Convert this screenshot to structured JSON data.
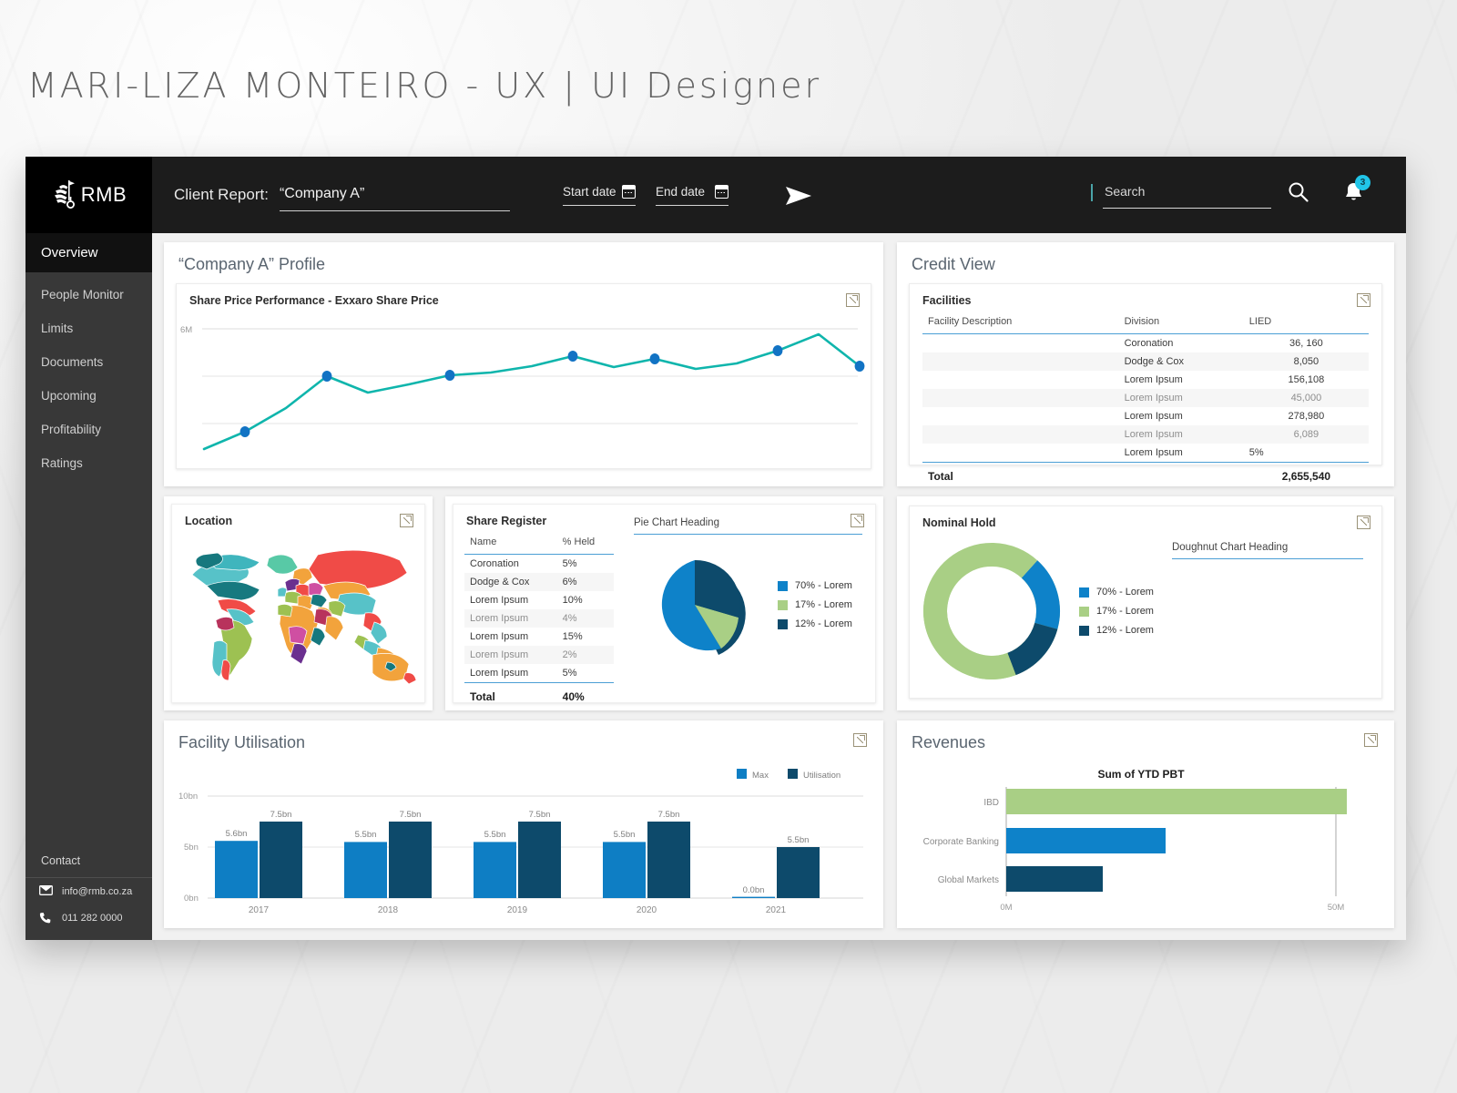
{
  "portfolio_title": "MARI-LIZA MONTEIRO - UX | UI Designer",
  "topbar": {
    "brand": "RMB",
    "client_report_label": "Client Report:",
    "company_value": "“Company A”",
    "start_date_label": "Start date",
    "end_date_label": "End date",
    "send_icon": "send-icon",
    "search_placeholder": "Search",
    "search_value": "",
    "notification_count": "3"
  },
  "sidebar": {
    "items": [
      {
        "label": "Overview",
        "active": true
      },
      {
        "label": "People Monitor",
        "active": false
      },
      {
        "label": "Limits",
        "active": false
      },
      {
        "label": "Documents",
        "active": false
      },
      {
        "label": "Upcoming",
        "active": false
      },
      {
        "label": "Profitability",
        "active": false
      },
      {
        "label": "Ratings",
        "active": false
      }
    ],
    "contact_title": "Contact",
    "email": "info@rmb.co.za",
    "phone": "011 282 0000"
  },
  "profile": {
    "title": "“Company A” Profile",
    "share_price_title": "Share Price Performance - Exxaro Share Price"
  },
  "credit_view": {
    "title": "Credit View"
  },
  "facilities": {
    "heading": "Facilities",
    "columns": [
      "Facility Description",
      "Division",
      "LIED"
    ],
    "rows": [
      {
        "desc": "",
        "division": "Coronation",
        "lied": "36, 160",
        "muted": false
      },
      {
        "desc": "",
        "division": "Dodge & Cox",
        "lied": "8,050",
        "muted": false
      },
      {
        "desc": "",
        "division": "Lorem Ipsum",
        "lied": "156,108",
        "muted": false
      },
      {
        "desc": "",
        "division": "Lorem Ipsum",
        "lied": "45,000",
        "muted": true
      },
      {
        "desc": "",
        "division": "Lorem Ipsum",
        "lied": "278,980",
        "muted": false
      },
      {
        "desc": "",
        "division": "Lorem Ipsum",
        "lied": "6,089",
        "muted": true
      },
      {
        "desc": "",
        "division": "Lorem Ipsum",
        "lied": "5%",
        "muted": false
      }
    ],
    "total_label": "Total",
    "total_value": "2,655,540"
  },
  "location": {
    "heading": "Location"
  },
  "share_register": {
    "heading": "Share Register",
    "columns": [
      "Name",
      "% Held"
    ],
    "rows": [
      {
        "name": "Coronation",
        "held": "5%",
        "muted": false
      },
      {
        "name": "Dodge & Cox",
        "held": "6%",
        "muted": false
      },
      {
        "name": "Lorem Ipsum",
        "held": "10%",
        "muted": false
      },
      {
        "name": "Lorem Ipsum",
        "held": "4%",
        "muted": true
      },
      {
        "name": "Lorem Ipsum",
        "held": "15%",
        "muted": false
      },
      {
        "name": "Lorem Ipsum",
        "held": "2%",
        "muted": true
      },
      {
        "name": "Lorem Ipsum",
        "held": "5%",
        "muted": false
      }
    ],
    "total_label": "Total",
    "total_value": "40%"
  },
  "nominal_hold": {
    "heading": "Nominal Hold",
    "doughnut_heading": "Doughnut Chart Heading"
  },
  "facility_utilisation": {
    "title": "Facility Utilisation"
  },
  "revenues": {
    "title": "Revenues"
  },
  "colors": {
    "blue": "#0e7ec4",
    "navy": "#0d4a6b",
    "green": "#a9cf85",
    "teal_line": "#0fb5ac",
    "dot_blue": "#1273c4",
    "accent_rule": "#4b9fd5",
    "badge": "#21c5e8",
    "sidebar": "#383838",
    "topbar": "#1c1c1c"
  },
  "chart_data": [
    {
      "id": "share-price-performance",
      "type": "line",
      "title": "Share Price Performance - Exxaro Share Price",
      "xlabel": "",
      "ylabel": "",
      "ylim": [
        0,
        6
      ],
      "yticks": [
        6
      ],
      "ytick_labels": [
        "6M"
      ],
      "grid": true,
      "legend": "none",
      "x": [
        0,
        1,
        2,
        3,
        4,
        5,
        6,
        7,
        8,
        9,
        10,
        11,
        12,
        13,
        14,
        15,
        16
      ],
      "values": [
        1.05,
        1.75,
        2.85,
        3.85,
        3.25,
        3.55,
        3.95,
        4.05,
        4.35,
        4.75,
        4.35,
        4.65,
        3.95,
        4.25,
        4.95,
        5.55,
        4.15
      ],
      "markers_at": [
        1,
        3,
        6,
        9,
        11,
        14,
        16
      ],
      "series_color": "#0fb5ac"
    },
    {
      "id": "share-register-pie",
      "type": "pie",
      "title": "Pie Chart Heading",
      "labels": [
        "70% - Lorem",
        "17% - Lorem",
        "12% - Lorem"
      ],
      "values": [
        70,
        17,
        12
      ],
      "colors": [
        "#0e82c9",
        "#a9cf85",
        "#0d4a6b"
      ],
      "legend": "right"
    },
    {
      "id": "nominal-hold-doughnut",
      "type": "pie",
      "title": "Doughnut Chart Heading",
      "labels": [
        "70% - Lorem",
        "17% - Lorem",
        "12% - Lorem"
      ],
      "values": [
        70,
        17,
        12
      ],
      "colors": [
        "#0e82c9",
        "#a9cf85",
        "#0d4a6b"
      ],
      "legend": "right",
      "doughnut": true
    },
    {
      "id": "facility-utilisation",
      "type": "bar",
      "title": "Facility Utilisation",
      "categories": [
        "2017",
        "2018",
        "2019",
        "2020",
        "2021"
      ],
      "series": [
        {
          "name": "Max",
          "values": [
            5.6,
            5.5,
            5.5,
            5.5,
            0.0
          ],
          "labels": [
            "5.6bn",
            "5.5bn",
            "5.5bn",
            "5.5bn",
            "0.0bn"
          ],
          "color": "#0e7ec4"
        },
        {
          "name": "Utilisation",
          "values": [
            7.5,
            7.5,
            7.5,
            7.5,
            5.5
          ],
          "labels": [
            "7.5bn",
            "7.5bn",
            "7.5bn",
            "7.5bn",
            "5.5bn"
          ],
          "color": "#0d4a6b"
        }
      ],
      "ylim": [
        0,
        10
      ],
      "yticks": [
        0,
        5,
        10
      ],
      "ytick_labels": [
        "0bn",
        "5bn",
        "10bn"
      ],
      "grid": true,
      "legend": "top-right"
    },
    {
      "id": "revenues",
      "type": "bar",
      "orientation": "horizontal",
      "title": "Revenues",
      "subtitle": "Sum of YTD PBT",
      "categories": [
        "IBD",
        "Corporate Banking",
        "Global Markets"
      ],
      "values": [
        51.5,
        21.0,
        12.5
      ],
      "colors": [
        "#a9cf85",
        "#0e82c9",
        "#0d4a6b"
      ],
      "xlim": [
        0,
        50
      ],
      "xticks": [
        0,
        50
      ],
      "xtick_labels": [
        "0M",
        "50M"
      ],
      "grid": true,
      "legend": "none"
    }
  ]
}
